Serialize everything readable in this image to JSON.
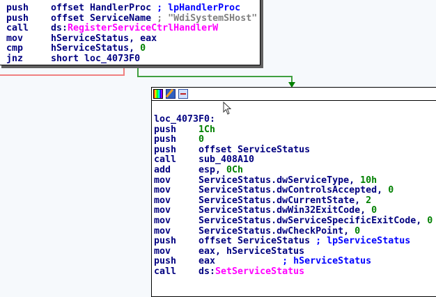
{
  "colors": {
    "text": "#000080",
    "number": "#008000",
    "comment": "#0000ff",
    "string": "#808080",
    "import": "#ff00ff",
    "edge_false": "#f08080",
    "edge_true": "#40a040"
  },
  "top_block": {
    "lines": [
      {
        "mn": "push",
        "ops": [
          [
            "offset HandlerProc ",
            "op"
          ],
          [
            "; lpHandlerProc",
            "cmt"
          ]
        ]
      },
      {
        "mn": "push",
        "ops": [
          [
            "offset ServiceName ",
            "op"
          ],
          [
            "; \"WdiSystemSHost\"",
            "str"
          ]
        ]
      },
      {
        "mn": "call",
        "ops": [
          [
            "ds:",
            "op"
          ],
          [
            "RegisterServiceCtrlHandlerW",
            "imp"
          ]
        ]
      },
      {
        "mn": "mov",
        "ops": [
          [
            "hServiceStatus, eax",
            "op"
          ]
        ]
      },
      {
        "mn": "cmp",
        "ops": [
          [
            "hServiceStatus, ",
            "op"
          ],
          [
            "0",
            "num"
          ]
        ]
      },
      {
        "mn": "jnz",
        "ops": [
          [
            "short loc_4073F0",
            "op"
          ]
        ]
      }
    ]
  },
  "bottom_block": {
    "header_icons": [
      "color-palette-icon",
      "edit-node-icon",
      "graph-node-icon"
    ],
    "label": "loc_4073F0:",
    "lines": [
      {
        "mn": "push",
        "ops": [
          [
            "1Ch",
            "num"
          ]
        ]
      },
      {
        "mn": "push",
        "ops": [
          [
            "0",
            "num"
          ]
        ]
      },
      {
        "mn": "push",
        "ops": [
          [
            "offset ServiceStatus",
            "op"
          ]
        ]
      },
      {
        "mn": "call",
        "ops": [
          [
            "sub_408A10",
            "op"
          ]
        ]
      },
      {
        "mn": "add",
        "ops": [
          [
            "esp, ",
            "op"
          ],
          [
            "0Ch",
            "num"
          ]
        ]
      },
      {
        "mn": "mov",
        "ops": [
          [
            "ServiceStatus.dwServiceType, ",
            "op"
          ],
          [
            "10h",
            "num"
          ]
        ]
      },
      {
        "mn": "mov",
        "ops": [
          [
            "ServiceStatus.dwControlsAccepted, ",
            "op"
          ],
          [
            "0",
            "num"
          ]
        ]
      },
      {
        "mn": "mov",
        "ops": [
          [
            "ServiceStatus.dwCurrentState, ",
            "op"
          ],
          [
            "2",
            "num"
          ]
        ]
      },
      {
        "mn": "mov",
        "ops": [
          [
            "ServiceStatus.dwWin32ExitCode, ",
            "op"
          ],
          [
            "0",
            "num"
          ]
        ]
      },
      {
        "mn": "mov",
        "ops": [
          [
            "ServiceStatus.dwServiceSpecificExitCode, ",
            "op"
          ],
          [
            "0",
            "num"
          ]
        ]
      },
      {
        "mn": "mov",
        "ops": [
          [
            "ServiceStatus.dwCheckPoint, ",
            "op"
          ],
          [
            "0",
            "num"
          ]
        ]
      },
      {
        "mn": "push",
        "ops": [
          [
            "offset ServiceStatus ",
            "op"
          ],
          [
            "; lpServiceStatus",
            "cmt"
          ]
        ]
      },
      {
        "mn": "mov",
        "ops": [
          [
            "eax, hServiceStatus",
            "op"
          ]
        ]
      },
      {
        "mn": "push",
        "ops": [
          [
            "eax            ",
            "op"
          ],
          [
            "; hServiceStatus",
            "cmt"
          ]
        ]
      },
      {
        "mn": "call",
        "ops": [
          [
            "ds:",
            "op"
          ],
          [
            "SetServiceStatus",
            "imp"
          ]
        ]
      }
    ]
  }
}
